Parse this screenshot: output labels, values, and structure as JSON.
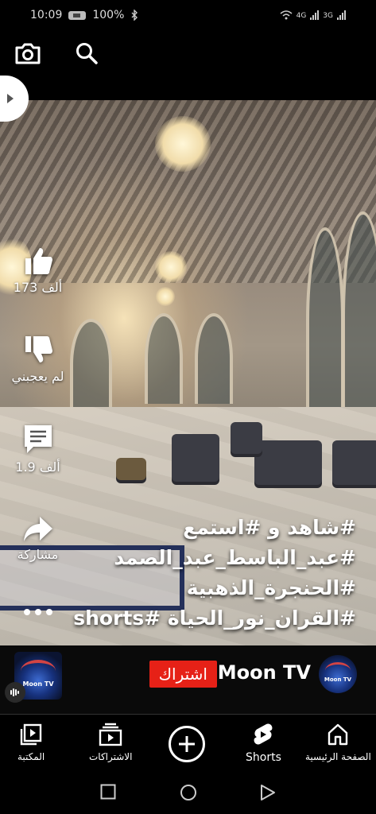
{
  "status_bar": {
    "time": "10:09",
    "battery": "100%",
    "network_a": "4G",
    "network_b": "3G"
  },
  "top_actions": {
    "camera_icon": "camera-icon",
    "search_icon": "search-icon"
  },
  "rail": {
    "like_count": "173 ألف",
    "dislike_label": "لم يعجبني",
    "comment_count": "1.9 ألف",
    "share_label": "مشاركة"
  },
  "hashtags": {
    "line1": "#شاهد و #استمع",
    "line2": "#عبد_الباسط_عبد_الصمد",
    "line3": "#الحنجرة_الذهبية",
    "line4": "#القران_نور_الحياة #shorts"
  },
  "channel": {
    "name": "Moon TV",
    "subscribe_label": "اشتراك",
    "avatar_text": "Moon TV",
    "sound_text": "Moon TV"
  },
  "nav": {
    "home": "الصفحة الرئيسية",
    "shorts": "Shorts",
    "subscriptions": "الاشتراكات",
    "library": "المكتبة"
  },
  "colors": {
    "subscribe": "#e62117",
    "background": "#000000"
  }
}
